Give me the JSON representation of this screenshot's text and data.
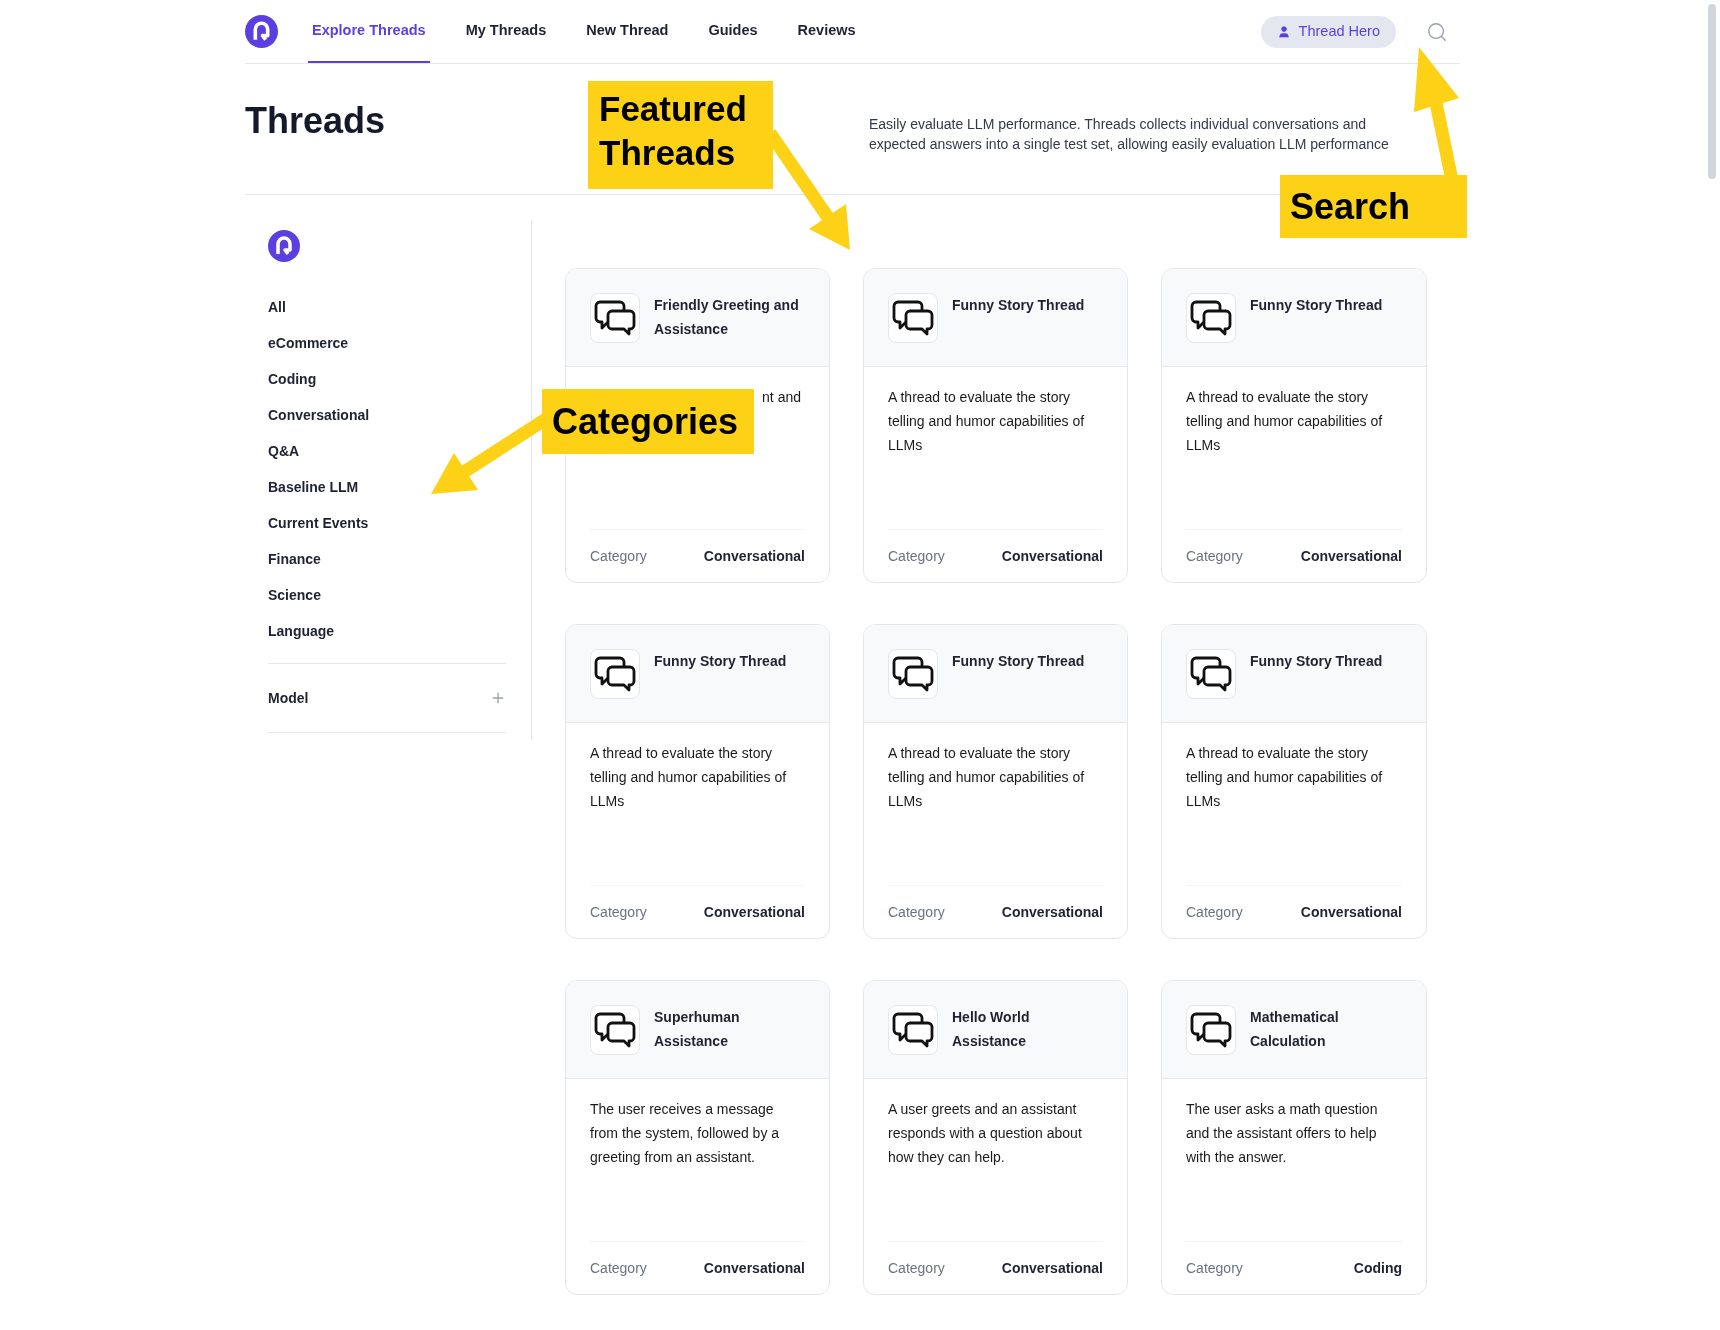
{
  "nav": {
    "tabs": [
      {
        "label": "Explore Threads",
        "selected": true
      },
      {
        "label": "My Threads",
        "selected": false
      },
      {
        "label": "New Thread",
        "selected": false
      },
      {
        "label": "Guides",
        "selected": false
      },
      {
        "label": "Reviews",
        "selected": false
      }
    ],
    "user": "Thread Hero"
  },
  "header": {
    "title": "Threads",
    "description": "Easily evaluate LLM performance. Threads collects individual conversations and expected answers into a single test set, allowing easily evaluation LLM performance"
  },
  "sidebar": {
    "categories": [
      "All",
      "eCommerce",
      "Coding",
      "Conversational",
      "Q&A",
      "Baseline LLM",
      "Current Events",
      "Finance",
      "Science",
      "Language"
    ],
    "filters": [
      {
        "label": "Model",
        "expanded": false
      }
    ]
  },
  "cards": [
    {
      "title": "Friendly Greeting and Assistance",
      "description": "nt and",
      "covered": true,
      "category_label": "Category",
      "category": "Conversational"
    },
    {
      "title": "Funny Story Thread",
      "description": "A thread to evaluate the story telling and humor capabilities of LLMs",
      "covered": false,
      "category_label": "Category",
      "category": "Conversational"
    },
    {
      "title": "Funny Story Thread",
      "description": "A thread to evaluate the story telling and humor capabilities of LLMs",
      "covered": false,
      "category_label": "Category",
      "category": "Conversational"
    },
    {
      "title": "Funny Story Thread",
      "description": "A thread to evaluate the story telling and humor capabilities of LLMs",
      "covered": false,
      "category_label": "Category",
      "category": "Conversational"
    },
    {
      "title": "Funny Story Thread",
      "description": "A thread to evaluate the story telling and humor capabilities of LLMs",
      "covered": false,
      "category_label": "Category",
      "category": "Conversational"
    },
    {
      "title": "Funny Story Thread",
      "description": "A thread to evaluate the story telling and humor capabilities of LLMs",
      "covered": false,
      "category_label": "Category",
      "category": "Conversational"
    },
    {
      "title": "Superhuman Assistance",
      "description": "The user receives a message from the system, followed by a greeting from an assistant.",
      "covered": false,
      "category_label": "Category",
      "category": "Conversational"
    },
    {
      "title": "Hello World Assistance",
      "description": "A user greets and an assistant responds with a question about how they can help.",
      "covered": false,
      "category_label": "Category",
      "category": "Conversational"
    },
    {
      "title": "Mathematical Calculation",
      "description": "The user asks a math question and the assistant offers to help with the answer.",
      "covered": false,
      "category_label": "Category",
      "category": "Coding"
    }
  ],
  "annotations": [
    {
      "label": "Featured Threads"
    },
    {
      "label": "Categories"
    },
    {
      "label": "Search"
    }
  ]
}
